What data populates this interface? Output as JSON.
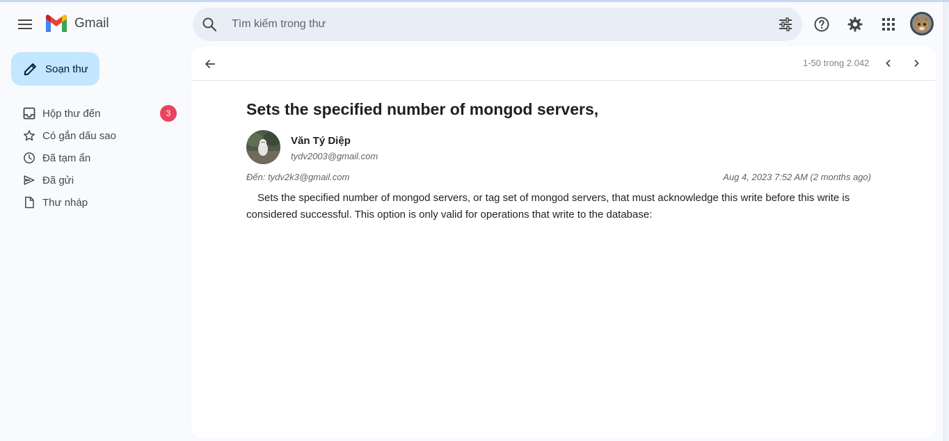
{
  "app": {
    "name": "Gmail"
  },
  "search": {
    "placeholder": "Tìm kiếm trong thư"
  },
  "compose": {
    "label": "Soạn thư"
  },
  "sidebar": {
    "items": [
      {
        "label": "Hộp thư đến",
        "icon": "inbox-icon",
        "badge": "3"
      },
      {
        "label": "Có gắn dấu sao",
        "icon": "star-icon"
      },
      {
        "label": "Đã tạm ẩn",
        "icon": "clock-icon"
      },
      {
        "label": "Đã gửi",
        "icon": "send-icon"
      },
      {
        "label": "Thư nháp",
        "icon": "draft-icon"
      }
    ]
  },
  "toolbar": {
    "pager": "1-50 trong 2.042"
  },
  "email": {
    "subject": "Sets the specified number of mongod servers,",
    "sender_name": "Văn Tý Diệp",
    "sender_email": "tydv2003@gmail.com",
    "to": "Đến: tydv2k3@gmail.com",
    "date": "Aug 4, 2023 7:52 AM (2 months ago)",
    "body": "Sets the specified number of mongod servers, or tag set of mongod servers, that must acknowledge this write before this write is considered successful. This option is only valid for operations that write to the database:"
  },
  "colors": {
    "background": "#f8fafd",
    "search_bg": "#e9eef6",
    "compose_bg": "#c2e7ff",
    "badge": "#ea4360"
  }
}
